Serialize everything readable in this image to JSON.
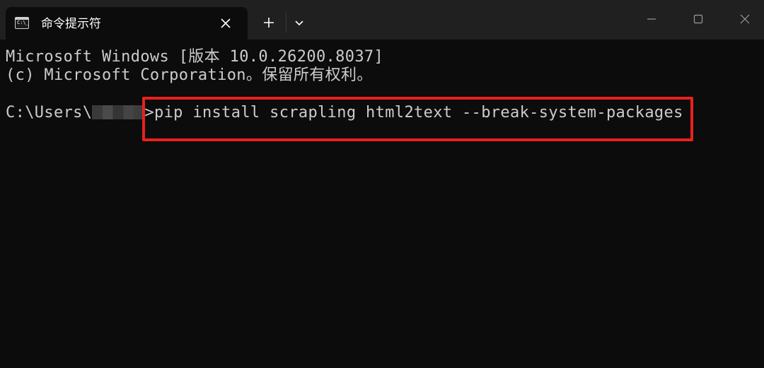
{
  "window": {
    "tab_title": "命令提示符",
    "tab_icon": "cmd-icon",
    "tab_icon_prompt": "C:\\_",
    "buttons": {
      "tab_close": "close-icon",
      "new_tab": "plus-icon",
      "dropdown": "chevron-down-icon",
      "minimize": "minimize-icon",
      "maximize": "maximize-icon",
      "close": "close-icon"
    }
  },
  "terminal": {
    "lines": [
      "Microsoft Windows [版本 10.0.26200.8037]",
      "(c) Microsoft Corporation。保留所有权利。"
    ],
    "prompt_prefix": "C:\\Users\\",
    "prompt_suffix": ">",
    "command": "pip install scrapling html2text --break-system-packages",
    "highlight_color": "#e8211e"
  },
  "colors": {
    "titlebar": "#202020",
    "background": "#0c0c0c",
    "text": "#cccccc"
  }
}
